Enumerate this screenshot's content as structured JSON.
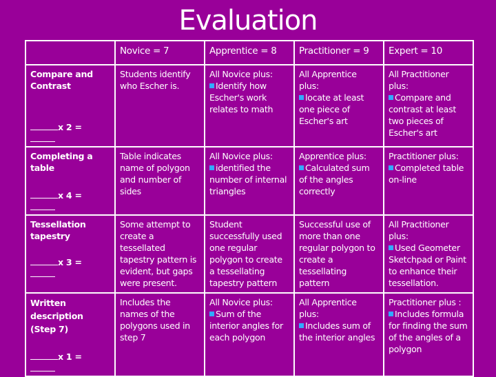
{
  "title": "Evaluation",
  "colors": {
    "background": "#990099",
    "text": "#ffffff",
    "border": "#ffffff",
    "bullet": "#33aaff"
  },
  "table": {
    "headers": [
      "",
      "Novice = 7",
      "Apprentice = 8",
      "Practitioner = 9",
      "Expert = 10"
    ],
    "rows": [
      {
        "criterion": "Compare and Contrast",
        "multiplier": "x 2 =",
        "novice": {
          "lead": "Students identify who Escher is.",
          "bullet": ""
        },
        "apprentice": {
          "lead": "All Novice plus:",
          "bullet": "Identify how Escher's work relates to math"
        },
        "practitioner": {
          "lead": "All Apprentice plus:",
          "bullet": "locate at least one piece of Escher's art"
        },
        "expert": {
          "lead": "All Practitioner plus:",
          "bullet": "Compare and contrast at least two pieces of Escher's art"
        }
      },
      {
        "criterion": "Completing a table",
        "multiplier": "x 4 =",
        "novice": {
          "lead": "Table indicates name of polygon and number of sides",
          "bullet": ""
        },
        "apprentice": {
          "lead": "All Novice plus:",
          "bullet": "identified the number of internal triangles"
        },
        "practitioner": {
          "lead": "Apprentice plus:",
          "bullet": "Calculated sum of the angles correctly"
        },
        "expert": {
          "lead": "Practitioner plus:",
          "bullet": "Completed table on-line"
        }
      },
      {
        "criterion": "Tessellation tapestry",
        "multiplier": "x 3 =",
        "novice": {
          "lead": "Some attempt to create a tessellated tapestry pattern is evident, but gaps were present.",
          "bullet": ""
        },
        "apprentice": {
          "lead": "Student successfully used one regular polygon to create a tessellating tapestry pattern",
          "bullet": ""
        },
        "practitioner": {
          "lead": "Successful use of more than one regular polygon to create a tessellating pattern",
          "bullet": ""
        },
        "expert": {
          "lead": "All Practitioner plus:",
          "bullet": "Used Geometer Sketchpad or Paint to enhance their tessellation."
        }
      },
      {
        "criterion": "Written description (Step 7)",
        "multiplier": "x 1 =",
        "novice": {
          "lead": "Includes the names of the polygons used in step 7",
          "bullet": ""
        },
        "apprentice": {
          "lead": "All Novice plus:",
          "bullet": "Sum of the interior angles for each polygon"
        },
        "practitioner": {
          "lead": "All Apprentice plus:",
          "bullet": "Includes sum of the interior angles"
        },
        "expert": {
          "lead": "Practitioner plus :",
          "bullet": "Includes formula for finding the sum of the angles of a polygon"
        }
      }
    ]
  }
}
